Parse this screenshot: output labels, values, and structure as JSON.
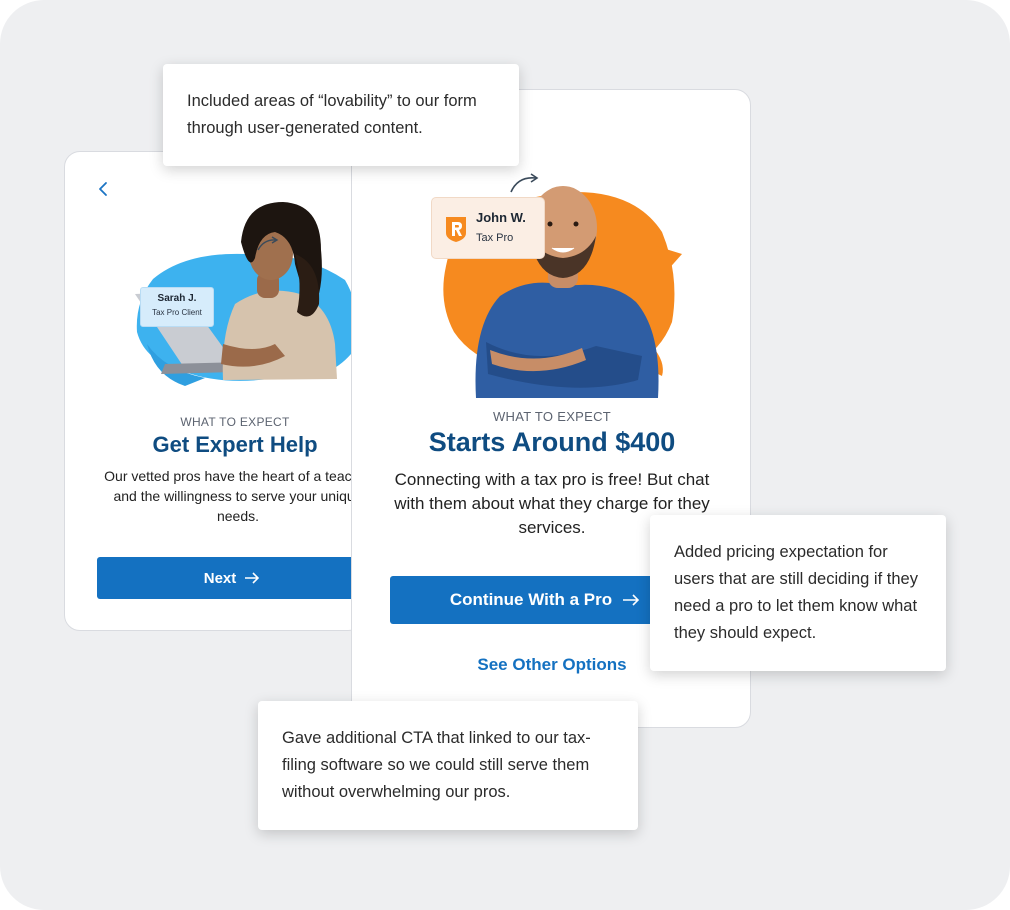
{
  "left_card": {
    "badge": {
      "name": "Sarah J.",
      "role": "Tax Pro Client"
    },
    "kicker": "WHAT TO EXPECT",
    "title": "Get Expert Help",
    "body": "Our vetted pros have the heart of a teacher and the willingness to serve your unique needs.",
    "next_label": "Next"
  },
  "main_card": {
    "badge": {
      "name": "John W.",
      "role": "Tax Pro"
    },
    "kicker": "WHAT TO EXPECT",
    "title": "Starts Around $400",
    "body": "Connecting with a tax pro is free! But chat with them about what they charge for they services.",
    "continue_label": "Continue With a Pro",
    "other_label": "See Other Options"
  },
  "callouts": {
    "top": "Included areas of “lovability” to our form through user-generated content.",
    "right": "Added pricing expectation for users that are still deciding if they need a pro to let them know what they should expect.",
    "bottom": "Gave additional CTA that linked to our tax-filing software so we could still serve them without overwhelming our pros."
  },
  "colors": {
    "brand_blue": "#1471c1",
    "title_navy": "#0f4c81",
    "accent_orange": "#f68a1f",
    "accent_sky": "#3db2ef",
    "background": "#eeeff1"
  },
  "icons": {
    "back": "chevron-left-icon",
    "arrow": "arrow-right-icon",
    "logo": "r-shield-logo-icon"
  }
}
